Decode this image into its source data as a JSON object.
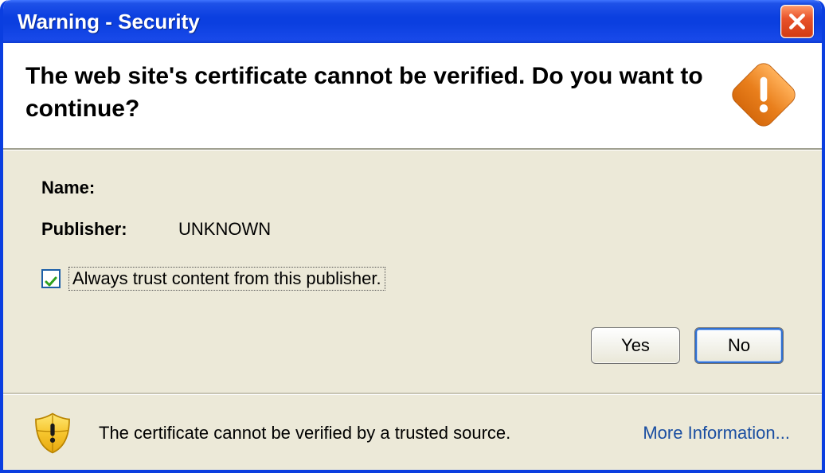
{
  "titlebar": {
    "title": "Warning - Security"
  },
  "header": {
    "message": "The web site's certificate cannot be verified.  Do you want to continue?"
  },
  "body": {
    "name_label": "Name:",
    "name_value": "",
    "publisher_label": "Publisher:",
    "publisher_value": "UNKNOWN",
    "trust_checkbox_label": "Always trust content from this publisher.",
    "trust_checkbox_checked": true
  },
  "buttons": {
    "yes_label": "Yes",
    "no_label": "No"
  },
  "footer": {
    "message": "The certificate cannot be verified by a trusted source.",
    "more_info_label": "More Information..."
  }
}
